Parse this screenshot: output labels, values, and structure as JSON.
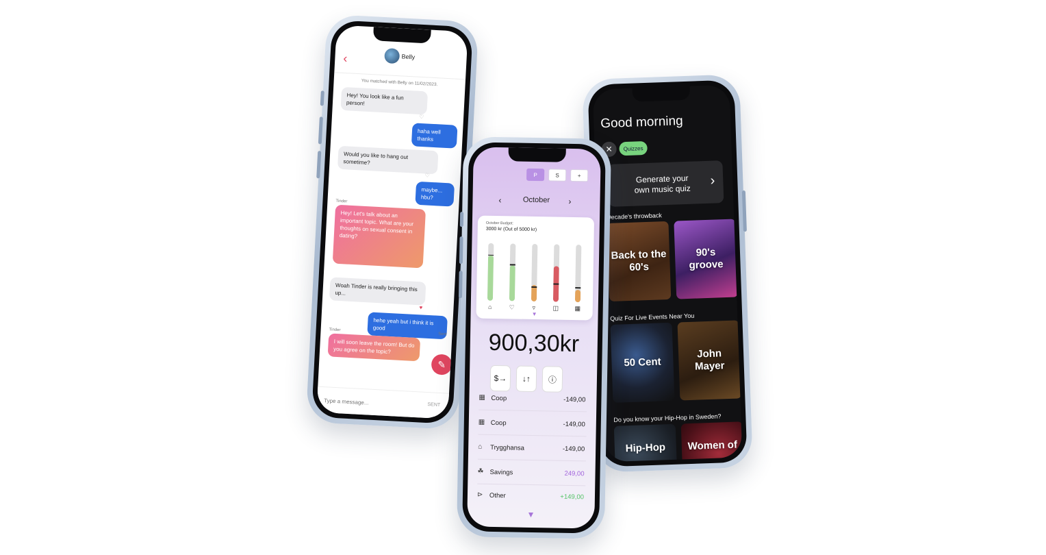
{
  "chat": {
    "contact_name": "Belly",
    "match_note": "You matched with Belly on 11/02/2023.",
    "messages": [
      {
        "text": "Hey! You look like a fun person!"
      },
      {
        "text": "haha well thanks"
      },
      {
        "text": "Would you like to hang out sometime?"
      },
      {
        "text": "maybe... hbu?"
      },
      {
        "sender": "Tinder",
        "text": "Hey! Let's talk about an important topic. What are your thoughts on sexual consent in dating?"
      },
      {
        "text": "Woah Tinder is really bringing this up..."
      },
      {
        "text": "hehe yeah but i think it is good",
        "status": "Sent"
      },
      {
        "sender": "Tinder",
        "text": "I will soon leave the room! But do you agree on the topic?"
      }
    ],
    "input_placeholder": "Type a message...",
    "send_label": "SENT",
    "colors": {
      "accent": "#e0455f",
      "outgoing": "#2d6ee0"
    }
  },
  "budget": {
    "segments": [
      "P",
      "S",
      "+"
    ],
    "active_segment": "P",
    "month": "October",
    "card_caption": "October Budget:",
    "card_amount": "3000 kr (Out of 5000 kr)",
    "category_bars": [
      {
        "icon": "home-icon",
        "fill": 0.78,
        "color": "#a8d99a",
        "limit": 0.78
      },
      {
        "icon": "heart-icon",
        "fill": 0.62,
        "color": "#a8d99a",
        "limit": 0.62
      },
      {
        "icon": "food-icon",
        "fill": 0.28,
        "color": "#e4a35a",
        "limit": 0.24
      },
      {
        "icon": "transport-icon",
        "fill": 0.62,
        "color": "#d95b62",
        "limit": 0.3
      },
      {
        "icon": "gift-icon",
        "fill": 0.22,
        "color": "#e4a35a",
        "limit": 0.24
      }
    ],
    "total": "900,30kr",
    "actions": [
      "$→",
      "↓↑",
      "ⓘ"
    ],
    "transactions": [
      {
        "icon": "gift-icon",
        "name": "Coop",
        "amount": "-149,00",
        "tone": "default"
      },
      {
        "icon": "gift-icon",
        "name": "Coop",
        "amount": "-149,00",
        "tone": "default"
      },
      {
        "icon": "home-icon",
        "name": "Trygghansa",
        "amount": "-149,00",
        "tone": "default"
      },
      {
        "icon": "piggy-bank-icon",
        "name": "Savings",
        "amount": "249,00",
        "tone": "purple"
      },
      {
        "icon": "other-icon",
        "name": "Other",
        "amount": "+149,00",
        "tone": "green"
      }
    ]
  },
  "music": {
    "greeting": "Good morning",
    "chip": "Quizzes",
    "generate_line1": "Generate your",
    "generate_line2": "own music quiz",
    "sections": [
      {
        "title": "Decade's throwback",
        "tiles": [
          {
            "label": "Back to the 60's"
          },
          {
            "label": "90's groove"
          }
        ]
      },
      {
        "title": "Quiz For Live Events Near You",
        "tiles": [
          {
            "label": "50 Cent"
          },
          {
            "label": "John Mayer"
          }
        ]
      },
      {
        "title": "Do you know your Hip-Hop in Sweden?",
        "tiles": [
          {
            "label": "Hip-Hop"
          },
          {
            "label": "Women of"
          }
        ]
      }
    ]
  }
}
